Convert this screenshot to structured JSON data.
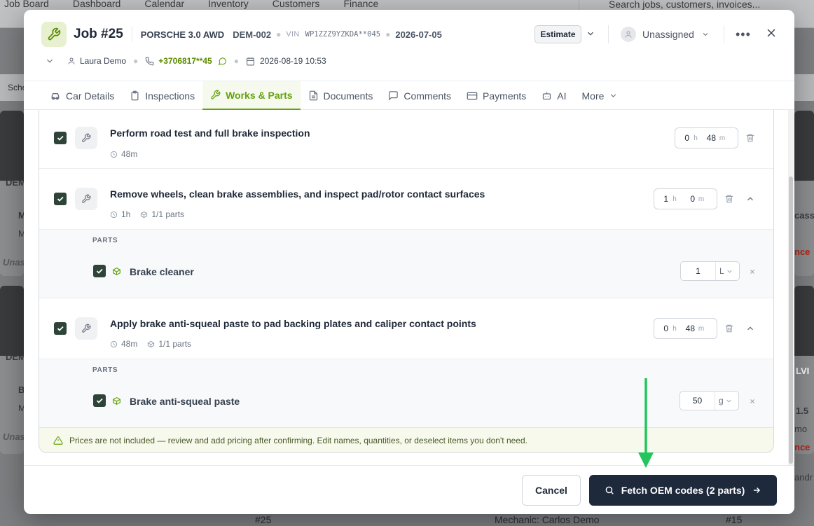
{
  "background": {
    "nav": [
      "Job Board",
      "Dashboard",
      "Calendar",
      "Inventory",
      "Customers",
      "Finance"
    ],
    "search_placeholder": "Search jobs, customers, invoices...",
    "schedule_label": "Sche",
    "left_card_texts": [
      "DEM",
      "M",
      "M",
      "Unas",
      "DEM",
      "B",
      "M",
      "Unas"
    ],
    "right_card_texts": [
      "cass",
      "nce",
      "LVI",
      "1.5",
      "mo",
      "nce",
      "andr"
    ],
    "bottom_items": [
      "#25",
      "Mechanic: Carlos Demo",
      "#15"
    ]
  },
  "job": {
    "title": "Job #25",
    "car": "PORSCHE 3.0 AWD",
    "plate": "DEM-002",
    "vin_label": "VIN",
    "vin": "WP1ZZZ9YZKDA**045",
    "date": "2026-07-05",
    "status": "Estimate",
    "assignee": "Unassigned",
    "customer": "Laura Demo",
    "phone": "+3706817**45",
    "appointment": "2026-08-19 10:53"
  },
  "tabs": [
    {
      "label": "Car Details",
      "icon": "car-icon"
    },
    {
      "label": "Inspections",
      "icon": "clipboard-icon"
    },
    {
      "label": "Works & Parts",
      "icon": "wrench-icon",
      "active": true
    },
    {
      "label": "Documents",
      "icon": "document-icon"
    },
    {
      "label": "Comments",
      "icon": "comment-icon"
    },
    {
      "label": "Payments",
      "icon": "card-icon"
    },
    {
      "label": "AI",
      "icon": "robot-icon"
    },
    {
      "label": "More",
      "icon": "chevron-down-icon"
    }
  ],
  "works": [
    {
      "title": "Perform road test and full brake inspection",
      "duration": "48m",
      "hours": "0",
      "minutes": "48",
      "parts_count": "",
      "parts": []
    },
    {
      "title": "Remove wheels, clean brake assemblies, and inspect pad/rotor contact surfaces",
      "duration": "1h",
      "hours": "1",
      "minutes": "0",
      "parts_count": "1/1 parts",
      "parts": [
        {
          "name": "Brake cleaner",
          "qty": "1",
          "unit": "L"
        }
      ]
    },
    {
      "title": "Apply brake anti-squeal paste to pad backing plates and caliper contact points",
      "duration": "48m",
      "hours": "0",
      "minutes": "48",
      "parts_count": "1/1 parts",
      "parts": [
        {
          "name": "Brake anti-squeal paste",
          "qty": "50",
          "unit": "g"
        }
      ]
    }
  ],
  "labels": {
    "hour_unit": "h",
    "minute_unit": "m",
    "parts_header": "PARTS"
  },
  "notice": "Prices are not included — review and add pricing after confirming. Edit names, quantities, or deselect items you don't need.",
  "footer": {
    "cancel": "Cancel",
    "fetch": "Fetch OEM codes (2 parts)"
  },
  "colors": {
    "accent": "#65a30d",
    "primary_button": "#1e293b",
    "checkbox": "#2f4438",
    "annotation_arrow": "#22c55e"
  }
}
